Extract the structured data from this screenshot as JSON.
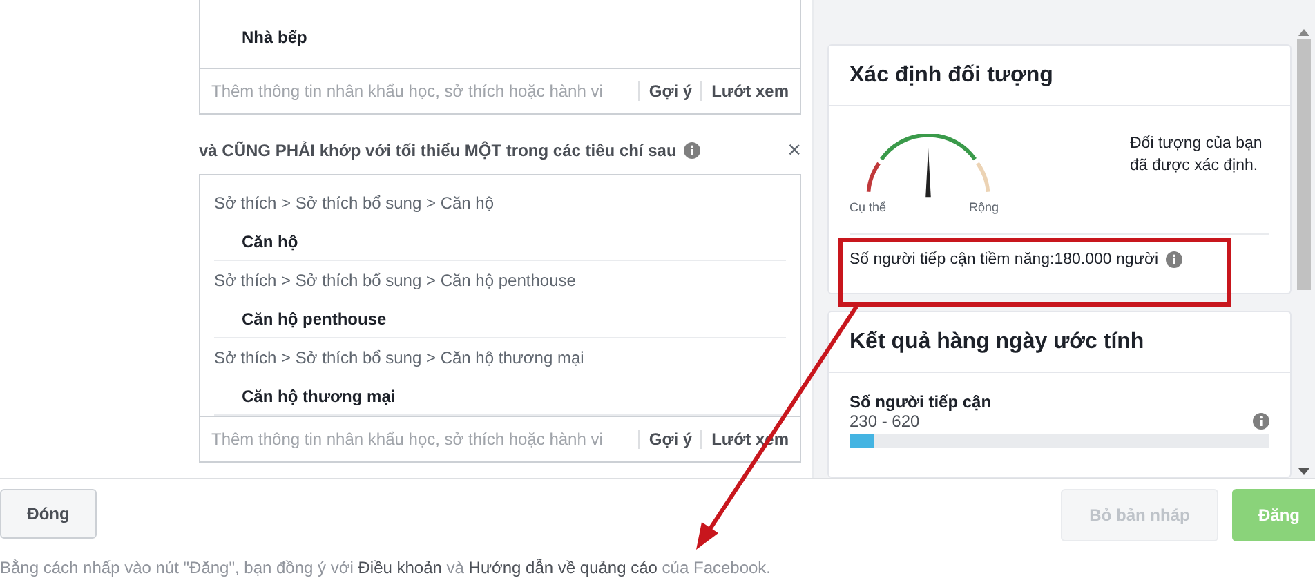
{
  "top_group": {
    "items": [
      {
        "name": "Nhà bếp"
      }
    ],
    "input": {
      "placeholder": "Thêm thông tin nhân khẩu học, sở thích hoặc hành vi",
      "actions": [
        "Gợi ý",
        "Lướt xem"
      ]
    }
  },
  "criteria": {
    "title": "và CŨNG PHẢI khớp với tối thiểu MỘT trong các tiêu chí sau",
    "close": "×",
    "items": [
      {
        "path": "Sở thích > Sở thích bổ sung > Căn hộ",
        "name": "Căn hộ"
      },
      {
        "path": "Sở thích > Sở thích bổ sung > Căn hộ penthouse",
        "name": "Căn hộ penthouse"
      },
      {
        "path": "Sở thích > Sở thích bổ sung > Căn hộ thương mại",
        "name": "Căn hộ thương mại"
      }
    ],
    "input": {
      "placeholder": "Thêm thông tin nhân khẩu học, sở thích hoặc hành vi",
      "actions": [
        "Gợi ý",
        "Lướt xem"
      ]
    }
  },
  "audience": {
    "title": "Xác định đối tượng",
    "gauge_left": "Cụ thể",
    "gauge_right": "Rộng",
    "message": "Đối tượng của bạn đã được xác định.",
    "potential_reach": "Số người tiếp cận tiềm năng:180.000 người"
  },
  "estimates": {
    "title": "Kết quả hàng ngày ước tính",
    "metrics": [
      {
        "label": "Số người tiếp cận",
        "range": "230 - 620",
        "level": 0.06
      }
    ]
  },
  "footer": {
    "close_button": "Đóng",
    "terms": [
      {
        "text": "Bằng cách nhấp vào nút \"Đăng\", bạn đồng ý với ",
        "kind": "plain"
      },
      {
        "text": "Điều khoản",
        "kind": "link"
      },
      {
        "text": " và ",
        "kind": "plain"
      },
      {
        "text": "Hướng dẫn về quảng cáo",
        "kind": "link"
      },
      {
        "text": " của Facebook.",
        "kind": "plain"
      }
    ],
    "buttons": [
      {
        "label": "Bỏ bản nháp",
        "kind": "secondary",
        "disabled": true
      },
      {
        "label": "Đăng",
        "kind": "primary",
        "disabled": true
      }
    ]
  }
}
